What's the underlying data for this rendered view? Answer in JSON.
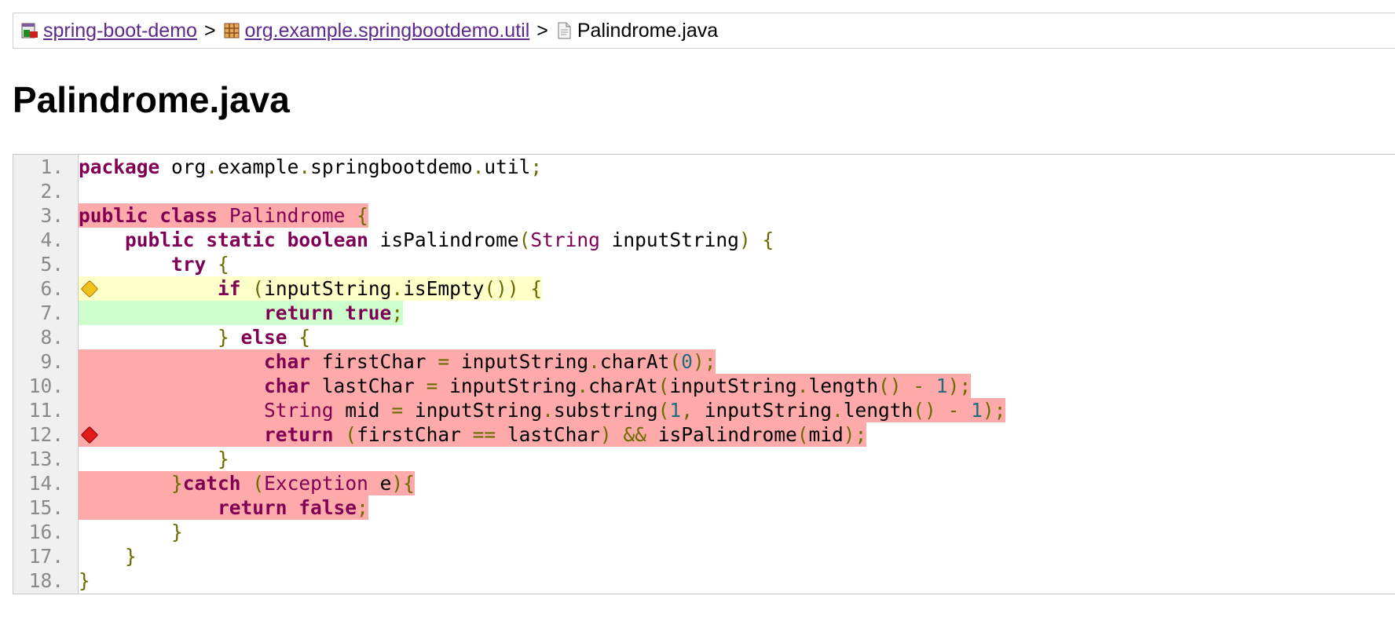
{
  "breadcrumb": {
    "project": "spring-boot-demo",
    "package": "org.example.springbootdemo.util",
    "file": "Palindrome.java",
    "separator": ">"
  },
  "title": "Palindrome.java",
  "colors": {
    "not_covered": "#ffaaaa",
    "partly_covered": "#ffffc8",
    "fully_covered": "#ccffcc",
    "keyword": "#7f0055",
    "link": "#5b2a8a"
  },
  "icons": {
    "project": "project-icon",
    "package": "package-icon",
    "file": "java-file-icon",
    "partial_branch": "yellow-diamond-icon",
    "missed_branch": "red-diamond-icon"
  },
  "code_lines": [
    {
      "num": "1.",
      "coverage": "",
      "marker": "",
      "text": "package org.example.springbootdemo.util;"
    },
    {
      "num": "2.",
      "coverage": "",
      "marker": "",
      "text": ""
    },
    {
      "num": "3.",
      "coverage": "not_covered",
      "marker": "",
      "text": "public class Palindrome {"
    },
    {
      "num": "4.",
      "coverage": "",
      "marker": "",
      "text": "    public static boolean isPalindrome(String inputString) {"
    },
    {
      "num": "5.",
      "coverage": "",
      "marker": "",
      "text": "        try {"
    },
    {
      "num": "6.",
      "coverage": "partly_covered",
      "marker": "partial",
      "text": "            if (inputString.isEmpty()) {"
    },
    {
      "num": "7.",
      "coverage": "fully_covered",
      "marker": "",
      "text": "                return true;"
    },
    {
      "num": "8.",
      "coverage": "",
      "marker": "",
      "text": "            } else {"
    },
    {
      "num": "9.",
      "coverage": "not_covered",
      "marker": "",
      "text": "                char firstChar = inputString.charAt(0);"
    },
    {
      "num": "10.",
      "coverage": "not_covered",
      "marker": "",
      "text": "                char lastChar = inputString.charAt(inputString.length() - 1);"
    },
    {
      "num": "11.",
      "coverage": "not_covered",
      "marker": "",
      "text": "                String mid = inputString.substring(1, inputString.length() - 1);"
    },
    {
      "num": "12.",
      "coverage": "not_covered",
      "marker": "missed",
      "text": "                return (firstChar == lastChar) && isPalindrome(mid);"
    },
    {
      "num": "13.",
      "coverage": "",
      "marker": "",
      "text": "            }"
    },
    {
      "num": "14.",
      "coverage": "not_covered",
      "marker": "",
      "text": "        }catch (Exception e){"
    },
    {
      "num": "15.",
      "coverage": "not_covered",
      "marker": "",
      "text": "            return false;"
    },
    {
      "num": "16.",
      "coverage": "",
      "marker": "",
      "text": "        }"
    },
    {
      "num": "17.",
      "coverage": "",
      "marker": "",
      "text": "    }"
    },
    {
      "num": "18.",
      "coverage": "",
      "marker": "",
      "text": "}"
    }
  ]
}
